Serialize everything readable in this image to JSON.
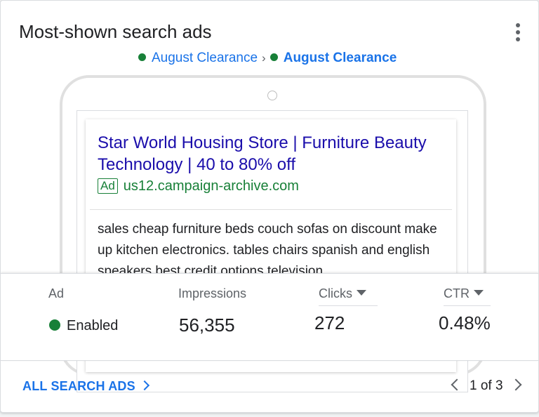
{
  "card": {
    "title": "Most-shown search ads",
    "menu_icon": "more-vert-icon"
  },
  "breadcrumb": {
    "campaign": "August Clearance",
    "separator": "›",
    "ad_group": "August Clearance",
    "status_color": "#188038"
  },
  "ad_preview": {
    "headline": "Star World Housing Store | Furniture Beauty Technology | 40 to 80% off",
    "badge": "Ad",
    "display_url": "us12.campaign-archive.com",
    "description": "sales cheap furniture beds couch sofas on discount make up kitchen electronics. tables chairs spanish and english speakers best credit options television"
  },
  "stats": {
    "ad_label": "Ad",
    "ad_status": "Enabled",
    "impressions_label": "Impressions",
    "impressions_value": "56,355",
    "clicks_label": "Clicks",
    "clicks_value": "272",
    "ctr_label": "CTR",
    "ctr_value": "0.48%"
  },
  "footer": {
    "all_link": "ALL SEARCH ADS",
    "pagination": "1 of 3"
  },
  "colors": {
    "link_blue": "#1a73e8",
    "headline_blue": "#1a0dab",
    "green": "#188038"
  }
}
